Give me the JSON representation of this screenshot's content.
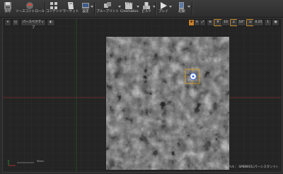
{
  "toolbar": {
    "buttons": [
      {
        "label": "保存",
        "icon": "save-icon"
      },
      {
        "label": "ソースコントロール",
        "icon": "source-control-icon"
      },
      {
        "label": "コンテンツ",
        "icon": "content-icon"
      },
      {
        "label": "マーケット",
        "icon": "marketplace-icon"
      },
      {
        "label": "設定",
        "icon": "settings-icon"
      },
      {
        "label": "ブループリント",
        "icon": "blueprint-icon"
      },
      {
        "label": "Cinematics",
        "icon": "cinematics-icon"
      },
      {
        "label": "ビルド",
        "icon": "build-icon"
      },
      {
        "label": "プレイ",
        "icon": "play-icon"
      },
      {
        "label": "起動",
        "icon": "launch-icon"
      }
    ]
  },
  "viewport": {
    "mode_label": "パースペクティブ",
    "right_chips": [
      "10",
      "10°",
      "0.25",
      "1"
    ],
    "status_text": "レベル：  SMBW01(パーシスタント)",
    "scale_label": "50cm"
  },
  "colors": {
    "accent": "#c7802a",
    "gizmo": "#e0a020",
    "background": "#242424",
    "grid": "#303030",
    "axis_x": "#a83030",
    "axis_y": "#2f8a2f"
  }
}
